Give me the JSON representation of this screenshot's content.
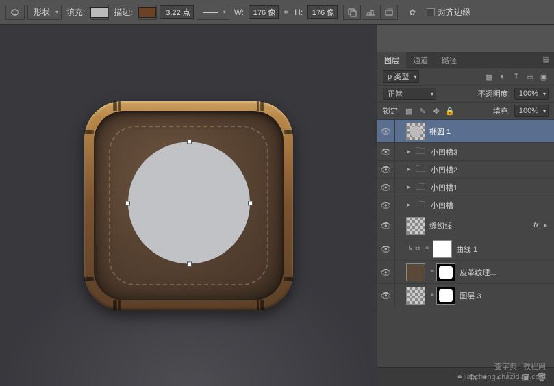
{
  "options_bar": {
    "mode_label": "形状",
    "fill_label": "填充:",
    "stroke_label": "描边:",
    "stroke_value": "3.22 点",
    "width_label": "W:",
    "width_value": "176 像",
    "height_label": "H:",
    "height_value": "176 像",
    "align_edges_label": "对齐边缘"
  },
  "panels": {
    "tabs": [
      "图层",
      "通道",
      "路径"
    ],
    "filter_prefix": "ρ",
    "filter_label": "类型",
    "blend_mode": "正常",
    "opacity_label": "不透明度:",
    "opacity_value": "100%",
    "lock_label": "锁定:",
    "fill_label": "填充:",
    "fill_value": "100%"
  },
  "layers": [
    {
      "name": "椭圆 1",
      "selected": true,
      "type": "shape",
      "visible": true
    },
    {
      "name": "小凹槽3",
      "type": "group",
      "visible": true
    },
    {
      "name": "小凹槽2",
      "type": "group",
      "visible": true
    },
    {
      "name": "小凹槽1",
      "type": "group",
      "visible": true
    },
    {
      "name": "小凹槽",
      "type": "group",
      "visible": true
    },
    {
      "name": "缝纫线",
      "type": "shape",
      "visible": true,
      "fx": true
    },
    {
      "name": "曲线 1",
      "type": "adjustment",
      "visible": true
    },
    {
      "name": "皮革纹理...",
      "type": "masked",
      "visible": true
    },
    {
      "name": "图层 3",
      "type": "masked2",
      "visible": true
    }
  ],
  "watermark": {
    "line1": "查字典 | 教程网",
    "line2": "jiaocheng.chazidian.com"
  },
  "chart_data": null
}
